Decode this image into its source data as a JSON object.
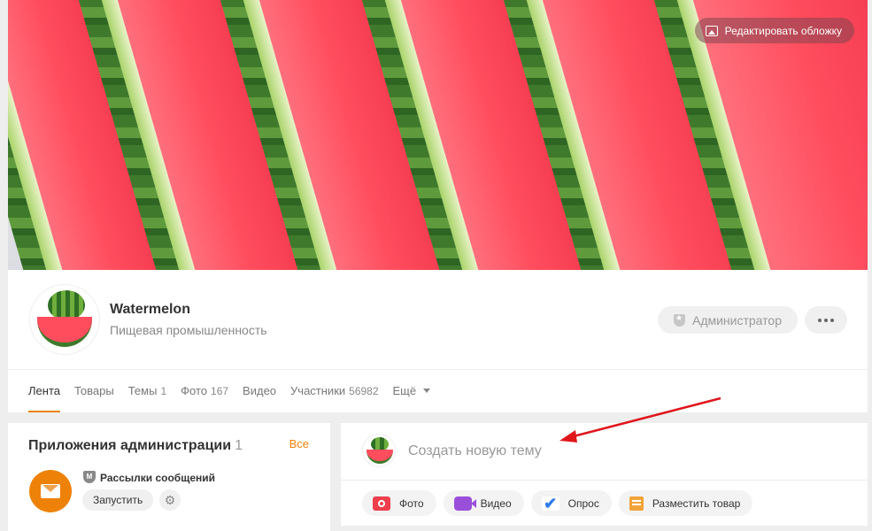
{
  "cover": {
    "edit_label": "Редактировать обложку"
  },
  "group": {
    "name": "Watermelon",
    "category": "Пищевая промышленность",
    "role_label": "Администратор"
  },
  "tabs": [
    {
      "label": "Лента",
      "count": ""
    },
    {
      "label": "Товары",
      "count": ""
    },
    {
      "label": "Темы",
      "count": "1"
    },
    {
      "label": "Фото",
      "count": "167"
    },
    {
      "label": "Видео",
      "count": ""
    },
    {
      "label": "Участники",
      "count": "56982"
    },
    {
      "label": "Ещё",
      "count": ""
    }
  ],
  "apps": {
    "title": "Приложения администрации",
    "count": "1",
    "all_label": "Все",
    "item": {
      "badge": "M",
      "name": "Рассылки сообщений",
      "run_label": "Запустить"
    }
  },
  "create_post": {
    "placeholder": "Создать новую тему",
    "actions": [
      {
        "label": "Фото",
        "icon": "camera-icon"
      },
      {
        "label": "Видео",
        "icon": "video-icon"
      },
      {
        "label": "Опрос",
        "icon": "poll-check-icon"
      },
      {
        "label": "Разместить товар",
        "icon": "product-icon"
      }
    ]
  },
  "colors": {
    "accent": "#ee8208",
    "annotation_arrow": "#e0161c"
  }
}
